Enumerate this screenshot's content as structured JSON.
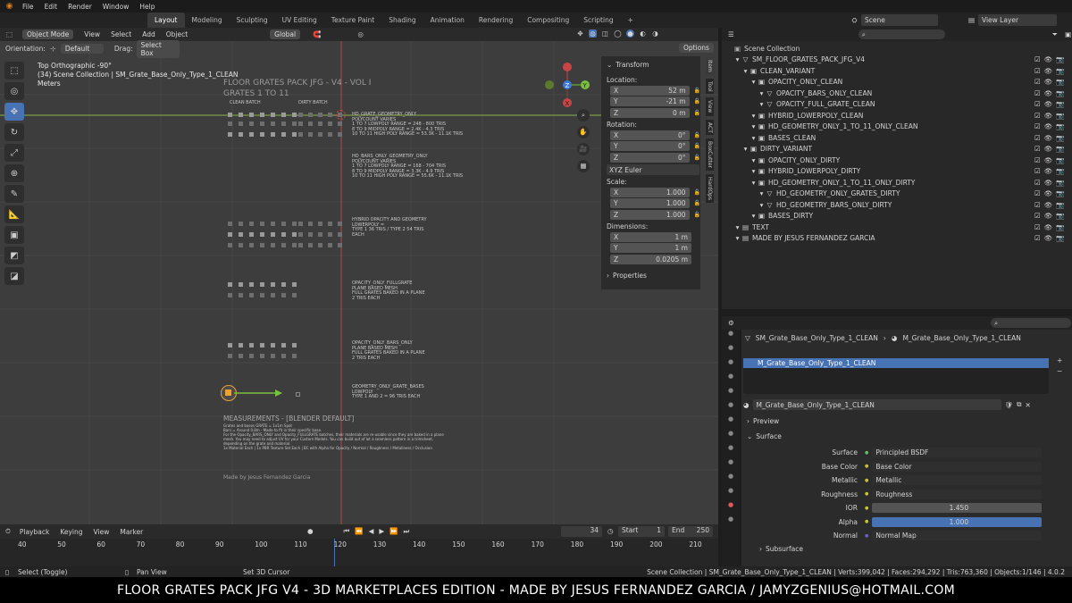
{
  "top_menu": [
    "File",
    "Edit",
    "Render",
    "Window",
    "Help"
  ],
  "workspace_tabs": [
    "Layout",
    "Modeling",
    "Sculpting",
    "UV Editing",
    "Texture Paint",
    "Shading",
    "Animation",
    "Rendering",
    "Compositing",
    "Scripting",
    "+"
  ],
  "scene_name": "Scene",
  "view_layer": "View Layer",
  "viewport_header": {
    "mode": "Object Mode",
    "menus": [
      "View",
      "Select",
      "Add",
      "Object"
    ],
    "transform_space": "Global",
    "options": "Options",
    "orientation_label": "Orientation:",
    "orientation_value": "Default",
    "drag_label": "Drag:",
    "drag_value": "Select Box"
  },
  "viewport_overlay": {
    "view_name": "Top Orthographic -90°",
    "collection": "(34) Scene Collection | SM_Grate_Base_Only_Type_1_CLEAN",
    "units": "Meters"
  },
  "scene_texts": {
    "title1": "FLOOR GRATES PACK JFG - V4 - VOL I",
    "title2": "GRATES 1 TO 11",
    "clean_batch": "CLEAN BATCH",
    "dirty_batch": "DIRTY BATCH",
    "block1": [
      "HD_GRATE_GEOMETRY_ONLY",
      "POLYCOUNT VARIES",
      "1 TO 7 LOWPOLY RANGE = 248 - 800 TRIS",
      "8 TO 9 MIDPOLY RANGE = 2.4K - 4.3 TRIS",
      "10 TO 11 HIGH POLY RANGE = 53.3K - 11.1K TRIS"
    ],
    "block2": [
      "HD_BARS_ONLY_GEOMETRY_ONLY",
      "POLYCOUNT VARIES",
      "1 TO 7 LOWPOLY RANGE = 168 - 704 TRIS",
      "8 TO 9 MIDPOLY RANGE = 3.3K - 4.9 TRIS",
      "10 TO 11 HIGH POLY RANGE = 55.6K - 11.1K TRIS"
    ],
    "block3": [
      "HYBRID OPACITY AND GEOMETRY",
      "LOWERPOLY =",
      "TYPE 1 36 TRIS / TYPE 2 54 TRIS",
      "EACH"
    ],
    "block4": [
      "OPACITY_ONLY_FULLGRATE",
      "PLANE BASED MESH",
      "FULL GRATES BAKED IN A PLANE",
      "2 TRIS EACH"
    ],
    "block5": [
      "OPACITY_ONLY_BARS_ONLY",
      "PLANE BASED MESH",
      "FULL GRATES BAKED IN A PLANE",
      "2 TRIS EACH"
    ],
    "block6": [
      "GEOMETRY_ONLY_GRATE_BASES",
      "LOWPOLY",
      "TYPE 1 AND 2 = 96 TRIS EACH"
    ],
    "measurements": "MEASUREMENTS - [BLENDER DEFAULT]",
    "meas_lines": [
      "Grates and bases GRATE = 1x1m Spot",
      "Bars = Around 0.8m - Made to fit in their specific base.",
      "For the Opacity_BARS_ONLY and Opacity_FULLGRATE batches, their materials are re-usable since they are baked in a plane mesh. You may need to adjust UV for your Custom Models. You can build out of lot a seamless pattern in a trimsheet, depending on the grate and material.",
      "1x Material Each | 1x PBR Texture Set Each | BC with Alpha for Opacity / Normal / Roughness / Metallness / Occlusion"
    ],
    "made_by": "Made by Jesus Fernandez Garcia"
  },
  "npanel": {
    "title": "Transform",
    "location_label": "Location:",
    "location": [
      {
        "axis": "X",
        "value": "52 m"
      },
      {
        "axis": "Y",
        "value": "-21 m"
      },
      {
        "axis": "Z",
        "value": "0 m"
      }
    ],
    "rotation_label": "Rotation:",
    "rotation": [
      {
        "axis": "X",
        "value": "0°"
      },
      {
        "axis": "Y",
        "value": "0°"
      },
      {
        "axis": "Z",
        "value": "0°"
      }
    ],
    "rotation_mode": "XYZ Euler",
    "scale_label": "Scale:",
    "scale": [
      {
        "axis": "X",
        "value": "1.000"
      },
      {
        "axis": "Y",
        "value": "1.000"
      },
      {
        "axis": "Z",
        "value": "1.000"
      }
    ],
    "dimensions_label": "Dimensions:",
    "dimensions": [
      {
        "axis": "X",
        "value": "1 m"
      },
      {
        "axis": "Y",
        "value": "1 m"
      },
      {
        "axis": "Z",
        "value": "0.0205 m"
      }
    ],
    "properties": "Properties"
  },
  "side_tabs": [
    "Item",
    "Tool",
    "View",
    "ACT",
    "BoxCutter",
    "HardOps"
  ],
  "outliner": {
    "rows": [
      {
        "label": "Scene Collection",
        "indent": 0
      },
      {
        "label": "SM_FLOOR_GRATES_PACK_JFG_V4",
        "indent": 1
      },
      {
        "label": "CLEAN_VARIANT",
        "indent": 2
      },
      {
        "label": "OPACITY_ONLY_CLEAN",
        "indent": 3
      },
      {
        "label": "OPACITY_BARS_ONLY_CLEAN",
        "indent": 4
      },
      {
        "label": "OPACITY_FULL_GRATE_CLEAN",
        "indent": 4
      },
      {
        "label": "HYBRID_LOWERPOLY_CLEAN",
        "indent": 3
      },
      {
        "label": "HD_GEOMETRY_ONLY_1_TO_11_ONLY_CLEAN",
        "indent": 3
      },
      {
        "label": "BASES_CLEAN",
        "indent": 3
      },
      {
        "label": "DIRTY_VARIANT",
        "indent": 2
      },
      {
        "label": "OPACITY_ONLY_DIRTY",
        "indent": 3
      },
      {
        "label": "HYBRID_LOWERPOLY_DIRTY",
        "indent": 3
      },
      {
        "label": "HD_GEOMETRY_ONLY_1_TO_11_ONLY_DIRTY",
        "indent": 3
      },
      {
        "label": "HD_GEOMETRY_ONLY_GRATES_DIRTY",
        "indent": 4
      },
      {
        "label": "HD_GEOMETRY_BARS_ONLY_DIRTY",
        "indent": 4
      },
      {
        "label": "BASES_DIRTY",
        "indent": 3
      },
      {
        "label": "TEXT",
        "indent": 1
      },
      {
        "label": "MADE BY JESUS FERNANDEZ GARCIA",
        "indent": 1
      }
    ]
  },
  "properties": {
    "breadcrumb_object": "SM_Grate_Base_Only_Type_1_CLEAN",
    "breadcrumb_material": "M_Grate_Base_Only_Type_1_CLEAN",
    "slot": "M_Grate_Base_Only_Type_1_CLEAN",
    "material_name": "M_Grate_Base_Only_Type_1_CLEAN",
    "preview": "Preview",
    "surface_section": "Surface",
    "rows": [
      {
        "label": "Surface",
        "value": "Principled BSDF"
      },
      {
        "label": "Base Color",
        "value": "Base Color"
      },
      {
        "label": "Metallic",
        "value": "Metallic"
      },
      {
        "label": "Roughness",
        "value": "Roughness"
      },
      {
        "label": "IOR",
        "value": "1.450"
      },
      {
        "label": "Alpha",
        "value": "1.000"
      },
      {
        "label": "Normal",
        "value": "Normal Map"
      }
    ],
    "subsurface": "Subsurface"
  },
  "timeline": {
    "menus": [
      "Playback",
      "Keying",
      "View",
      "Marker"
    ],
    "current_frame": "34",
    "start_label": "Start",
    "start": "1",
    "end_label": "End",
    "end": "250",
    "ticks": [
      "40",
      "50",
      "60",
      "70",
      "80",
      "90",
      "100",
      "110",
      "120",
      "130",
      "140",
      "150",
      "160",
      "170",
      "180",
      "190",
      "200",
      "210"
    ]
  },
  "statusbar": {
    "left1": "Select (Toggle)",
    "left2": "Pan View",
    "left3": "Set 3D Cursor",
    "right": "Scene Collection | SM_Grate_Base_Only_Type_1_CLEAN | Verts:399,042 | Faces:294,292 | Tris:763,360 | Objects:1/146 | 4.0.2"
  },
  "banner": "FLOOR GRATES PACK JFG V4 - 3D MARKETPLACES EDITION - MADE BY JESUS FERNANDEZ GARCIA / JAMYZGENIUS@HOTMAIL.COM",
  "colors": {
    "accent": "#4772b3",
    "x_axis": "#e04848",
    "y_axis": "#78c03c",
    "z_axis": "#3b78d8",
    "selected_orange": "#e8a338"
  }
}
